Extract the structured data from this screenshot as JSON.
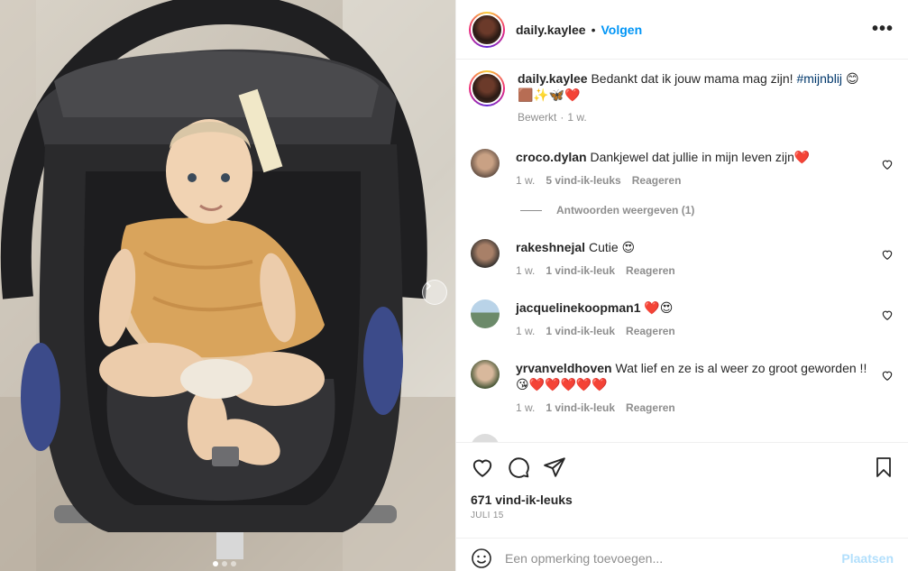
{
  "header": {
    "username": "daily.kaylee",
    "separator": "•",
    "follow_label": "Volgen",
    "more_label": "•••"
  },
  "caption": {
    "username": "daily.kaylee",
    "text": "Bedankt dat ik jouw mama mag zijn!",
    "hashtag": "#mijnblij",
    "emojis_line1": "😊",
    "emojis_line2": "🟫✨🦋❤️",
    "edited": "Bewerkt",
    "time": "1 w."
  },
  "comments": [
    {
      "username": "croco.dylan",
      "text": "Dankjewel dat jullie in mijn leven zijn❤️",
      "time": "1 w.",
      "likes": "5 vind-ik-leuks",
      "reply": "Reageren"
    },
    {
      "username": "rakeshnejal",
      "text": "Cutie 😍",
      "time": "1 w.",
      "likes": "1 vind-ik-leuk",
      "reply": "Reageren"
    },
    {
      "username": "jacquelinekoopman1",
      "text": "❤️😍",
      "time": "1 w.",
      "likes": "1 vind-ik-leuk",
      "reply": "Reageren"
    },
    {
      "username": "yrvanveldhoven",
      "text": "Wat lief en ze is al weer zo groot geworden !! 😘❤️❤️❤️❤️❤️",
      "time": "1 w.",
      "likes": "1 vind-ik-leuk",
      "reply": "Reageren"
    }
  ],
  "view_replies": "Antwoorden weergeven (1)",
  "likes_count": "671 vind-ik-leuks",
  "post_date": "JULI 15",
  "add_comment": {
    "placeholder": "Een opmerking toevoegen...",
    "post_label": "Plaatsen"
  },
  "icons": {
    "like": "heart-icon",
    "comment": "comment-icon",
    "share": "share-icon",
    "save": "bookmark-icon",
    "emoji": "emoji-icon",
    "next": "chevron-right-icon",
    "more": "more-icon"
  },
  "colors": {
    "link_blue": "#0095f6",
    "hashtag": "#00376b",
    "muted": "#8e8e8e",
    "post_disabled": "#b2dffc"
  },
  "carousel": {
    "slide": 1,
    "total": 3
  }
}
